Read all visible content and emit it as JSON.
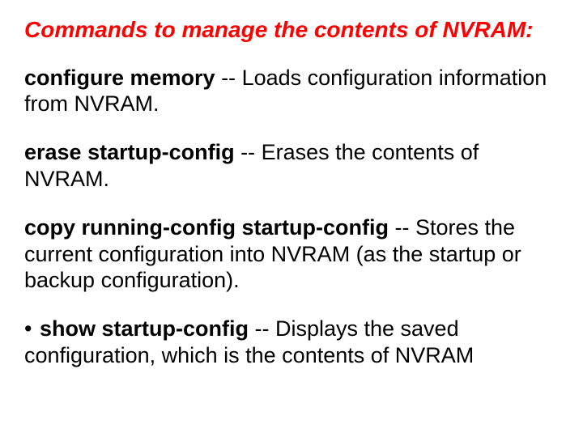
{
  "title": "Commands to manage the contents of NVRAM:",
  "items": [
    {
      "command": "configure memory",
      "sep": " -- ",
      "desc": "Loads configuration information from NVRAM."
    },
    {
      "command": "erase startup-config",
      "sep": " -- ",
      "desc": "Erases the contents of NVRAM."
    },
    {
      "command": "copy running-config startup-config",
      "sep": " -- ",
      "desc": "Stores the current configuration into NVRAM (as the startup or backup configuration)."
    },
    {
      "command": "show startup-config",
      "sep": " -- ",
      "desc": "Displays the saved configuration, which is the contents of NVRAM"
    }
  ],
  "bullet": "•"
}
